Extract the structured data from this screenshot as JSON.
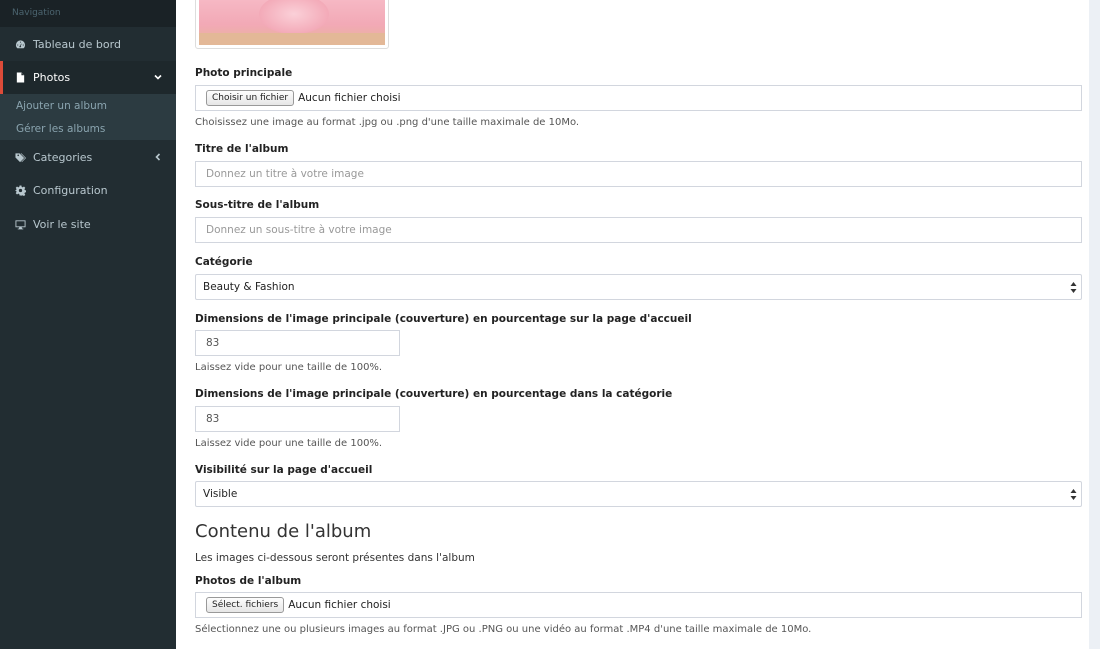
{
  "sidebar": {
    "header": "Navigation",
    "items": [
      {
        "label": "Tableau de bord",
        "icon": "dashboard-icon"
      },
      {
        "label": "Photos",
        "icon": "file-icon"
      },
      {
        "label": "Categories",
        "icon": "tags-icon"
      },
      {
        "label": "Configuration",
        "icon": "gear-icon"
      },
      {
        "label": "Voir le site",
        "icon": "desktop-icon"
      }
    ],
    "submenu": [
      {
        "label": "Ajouter un album"
      },
      {
        "label": "Gérer les albums"
      }
    ],
    "accent_color": "#dd4b39"
  },
  "form": {
    "main_photo": {
      "label": "Photo principale",
      "button": "Choisir un fichier",
      "status": "Aucun fichier choisi",
      "help": "Choisissez une image au format .jpg ou .png d'une taille maximale de 10Mo."
    },
    "title": {
      "label": "Titre de l'album",
      "placeholder": "Donnez un titre à votre image"
    },
    "subtitle": {
      "label": "Sous-titre de l'album",
      "placeholder": "Donnez un sous-titre à votre image"
    },
    "category": {
      "label": "Catégorie",
      "selected": "Beauty & Fashion"
    },
    "size_home": {
      "label": "Dimensions de l'image principale (couverture) en pourcentage sur la page d'accueil",
      "value": "83",
      "help": "Laissez vide pour une taille de 100%."
    },
    "size_category": {
      "label": "Dimensions de l'image principale (couverture) en pourcentage dans la catégorie",
      "value": "83",
      "help": "Laissez vide pour une taille de 100%."
    },
    "visibility": {
      "label": "Visibilité sur la page d'accueil",
      "selected": "Visible"
    }
  },
  "album_content": {
    "heading": "Contenu de l'album",
    "description": "Les images ci-dessous seront présentes dans l'album",
    "photos": {
      "label": "Photos de l'album",
      "button": "Sélect. fichiers",
      "status": "Aucun fichier choisi",
      "help": "Sélectionnez une ou plusieurs images au format .JPG ou .PNG ou une vidéo au format .MP4 d'une taille maximale de 10Mo."
    }
  }
}
